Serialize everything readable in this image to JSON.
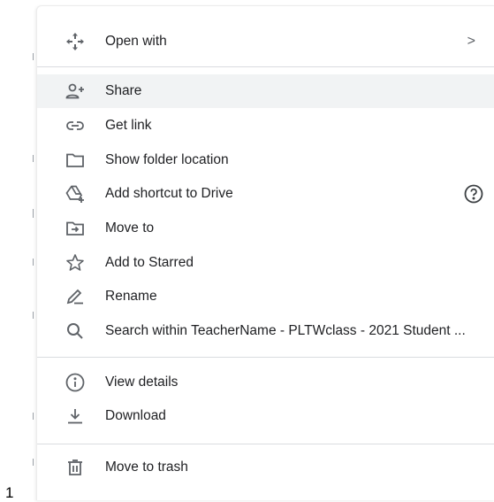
{
  "menu": {
    "open_with": "Open with",
    "open_with_chevron": ">",
    "share": "Share",
    "get_link": "Get link",
    "show_folder_location": "Show folder location",
    "add_shortcut": "Add shortcut to Drive",
    "move_to": "Move to",
    "add_to_starred": "Add to Starred",
    "rename": "Rename",
    "search_within": "Search within TeacherName - PLTWclass - 2021 Student ...",
    "view_details": "View details",
    "download": "Download",
    "move_to_trash": "Move to trash"
  },
  "page_number": "1",
  "colors": {
    "icon": "#5f6368",
    "text": "#202124",
    "highlight": "#f1f3f4",
    "divider": "#dadce0"
  }
}
